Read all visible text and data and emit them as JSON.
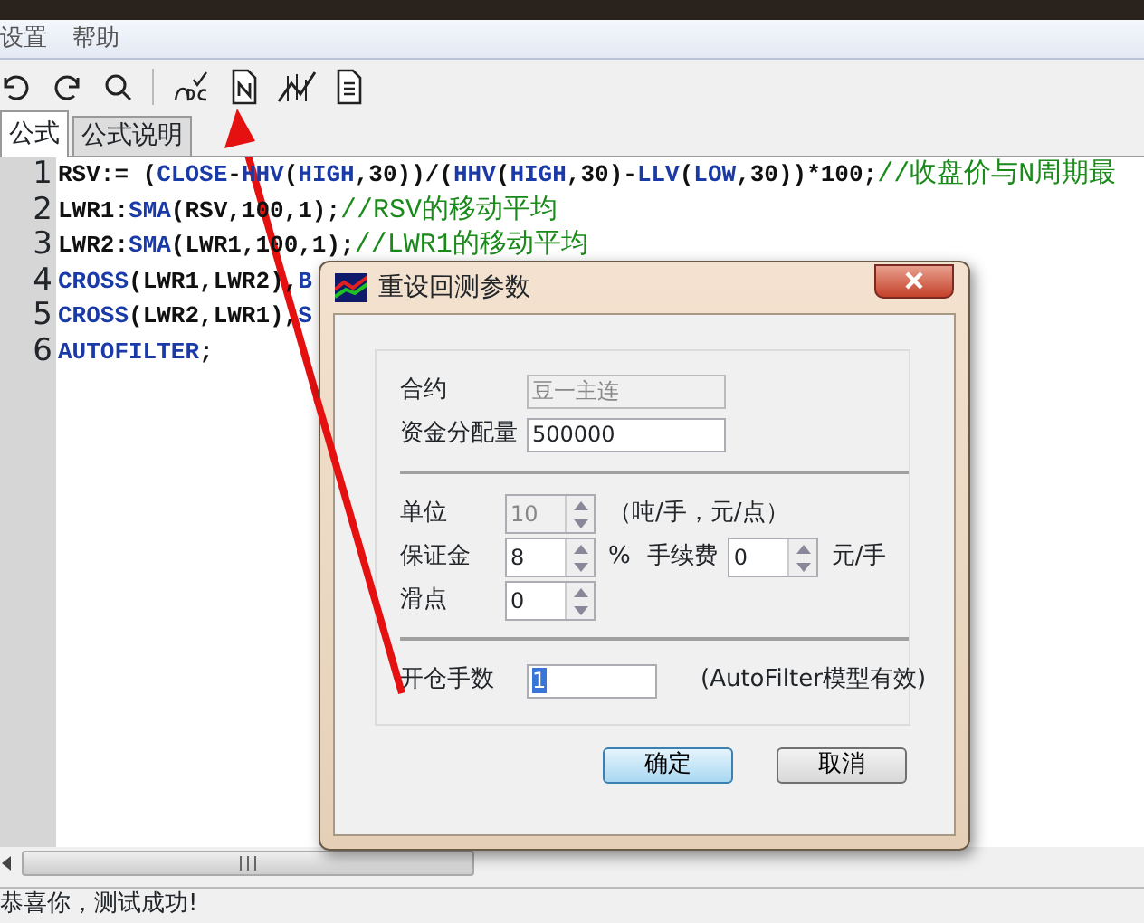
{
  "menu": [
    {
      "label": "设置"
    },
    {
      "label": "帮助"
    }
  ],
  "tabs": [
    {
      "label": "公式",
      "selected": true
    },
    {
      "label": "公式说明",
      "selected": false
    }
  ],
  "code_lines": [
    {
      "number": "1",
      "tokens": [
        {
          "kind": "plain",
          "text": "RSV:= ("
        },
        {
          "kind": "func",
          "text": "CLOSE"
        },
        {
          "kind": "plain",
          "text": "-"
        },
        {
          "kind": "func",
          "text": "HHV"
        },
        {
          "kind": "plain",
          "text": "("
        },
        {
          "kind": "func",
          "text": "HIGH"
        },
        {
          "kind": "plain",
          "text": ",30))/("
        },
        {
          "kind": "func",
          "text": "HHV"
        },
        {
          "kind": "plain",
          "text": "("
        },
        {
          "kind": "func",
          "text": "HIGH"
        },
        {
          "kind": "plain",
          "text": ",30)-"
        },
        {
          "kind": "func",
          "text": "LLV"
        },
        {
          "kind": "plain",
          "text": "("
        },
        {
          "kind": "func",
          "text": "LOW"
        },
        {
          "kind": "plain",
          "text": ",30))*100;"
        },
        {
          "kind": "comment",
          "text": "//收盘价与N周期最"
        }
      ]
    },
    {
      "number": "2",
      "tokens": [
        {
          "kind": "plain",
          "text": "LWR1:"
        },
        {
          "kind": "func",
          "text": "SMA"
        },
        {
          "kind": "plain",
          "text": "(RSV,100,1);"
        },
        {
          "kind": "comment",
          "text": "//RSV的移动平均"
        }
      ]
    },
    {
      "number": "3",
      "tokens": [
        {
          "kind": "plain",
          "text": "LWR2:"
        },
        {
          "kind": "func",
          "text": "SMA"
        },
        {
          "kind": "plain",
          "text": "(LWR1,100,1);"
        },
        {
          "kind": "comment",
          "text": "//LWR1的移动平均"
        }
      ]
    },
    {
      "number": "4",
      "tokens": [
        {
          "kind": "func",
          "text": "CROSS"
        },
        {
          "kind": "plain",
          "text": "(LWR1,LWR2),"
        },
        {
          "kind": "func",
          "text": "B"
        }
      ]
    },
    {
      "number": "5",
      "tokens": [
        {
          "kind": "func",
          "text": "CROSS"
        },
        {
          "kind": "plain",
          "text": "(LWR2,LWR1),"
        },
        {
          "kind": "func",
          "text": "S"
        }
      ]
    },
    {
      "number": "6",
      "tokens": [
        {
          "kind": "func",
          "text": "AUTOFILTER"
        },
        {
          "kind": "plain",
          "text": ";"
        }
      ]
    }
  ],
  "status_bar": {
    "text": "恭喜你，测试成功!"
  },
  "dialog": {
    "title": "重设回测参数",
    "sections": [
      {
        "rows": [
          [
            {
              "kind": "label",
              "text": "合约"
            },
            {
              "kind": "text",
              "value": "豆一主连",
              "disabled": true
            }
          ],
          [
            {
              "kind": "label",
              "text": "资金分配量"
            },
            {
              "kind": "text",
              "value": "500000",
              "disabled": false
            }
          ]
        ]
      },
      {
        "rows": [
          [
            {
              "kind": "label",
              "text": "单位"
            },
            {
              "kind": "spin",
              "value": "10",
              "disabled": true
            },
            {
              "kind": "note",
              "text": "（吨/手，元/点）"
            }
          ],
          [
            {
              "kind": "label",
              "text": "保证金"
            },
            {
              "kind": "spin",
              "value": "8",
              "disabled": false
            },
            {
              "kind": "note",
              "text": "%"
            },
            {
              "kind": "label",
              "text": "手续费"
            },
            {
              "kind": "spin",
              "value": "0",
              "disabled": false
            },
            {
              "kind": "note",
              "text": "元/手"
            }
          ],
          [
            {
              "kind": "label",
              "text": "滑点"
            },
            {
              "kind": "spin",
              "value": "0",
              "disabled": false
            }
          ]
        ]
      },
      {
        "rows": [
          [
            {
              "kind": "label",
              "text": "开仓手数"
            },
            {
              "kind": "text",
              "value": "1",
              "disabled": false,
              "selected": true
            },
            {
              "kind": "note",
              "text": "(AutoFilter模型有效)"
            }
          ]
        ]
      }
    ],
    "buttons": [
      {
        "label": "确定",
        "default": true
      },
      {
        "label": "取消",
        "default": false
      }
    ]
  }
}
